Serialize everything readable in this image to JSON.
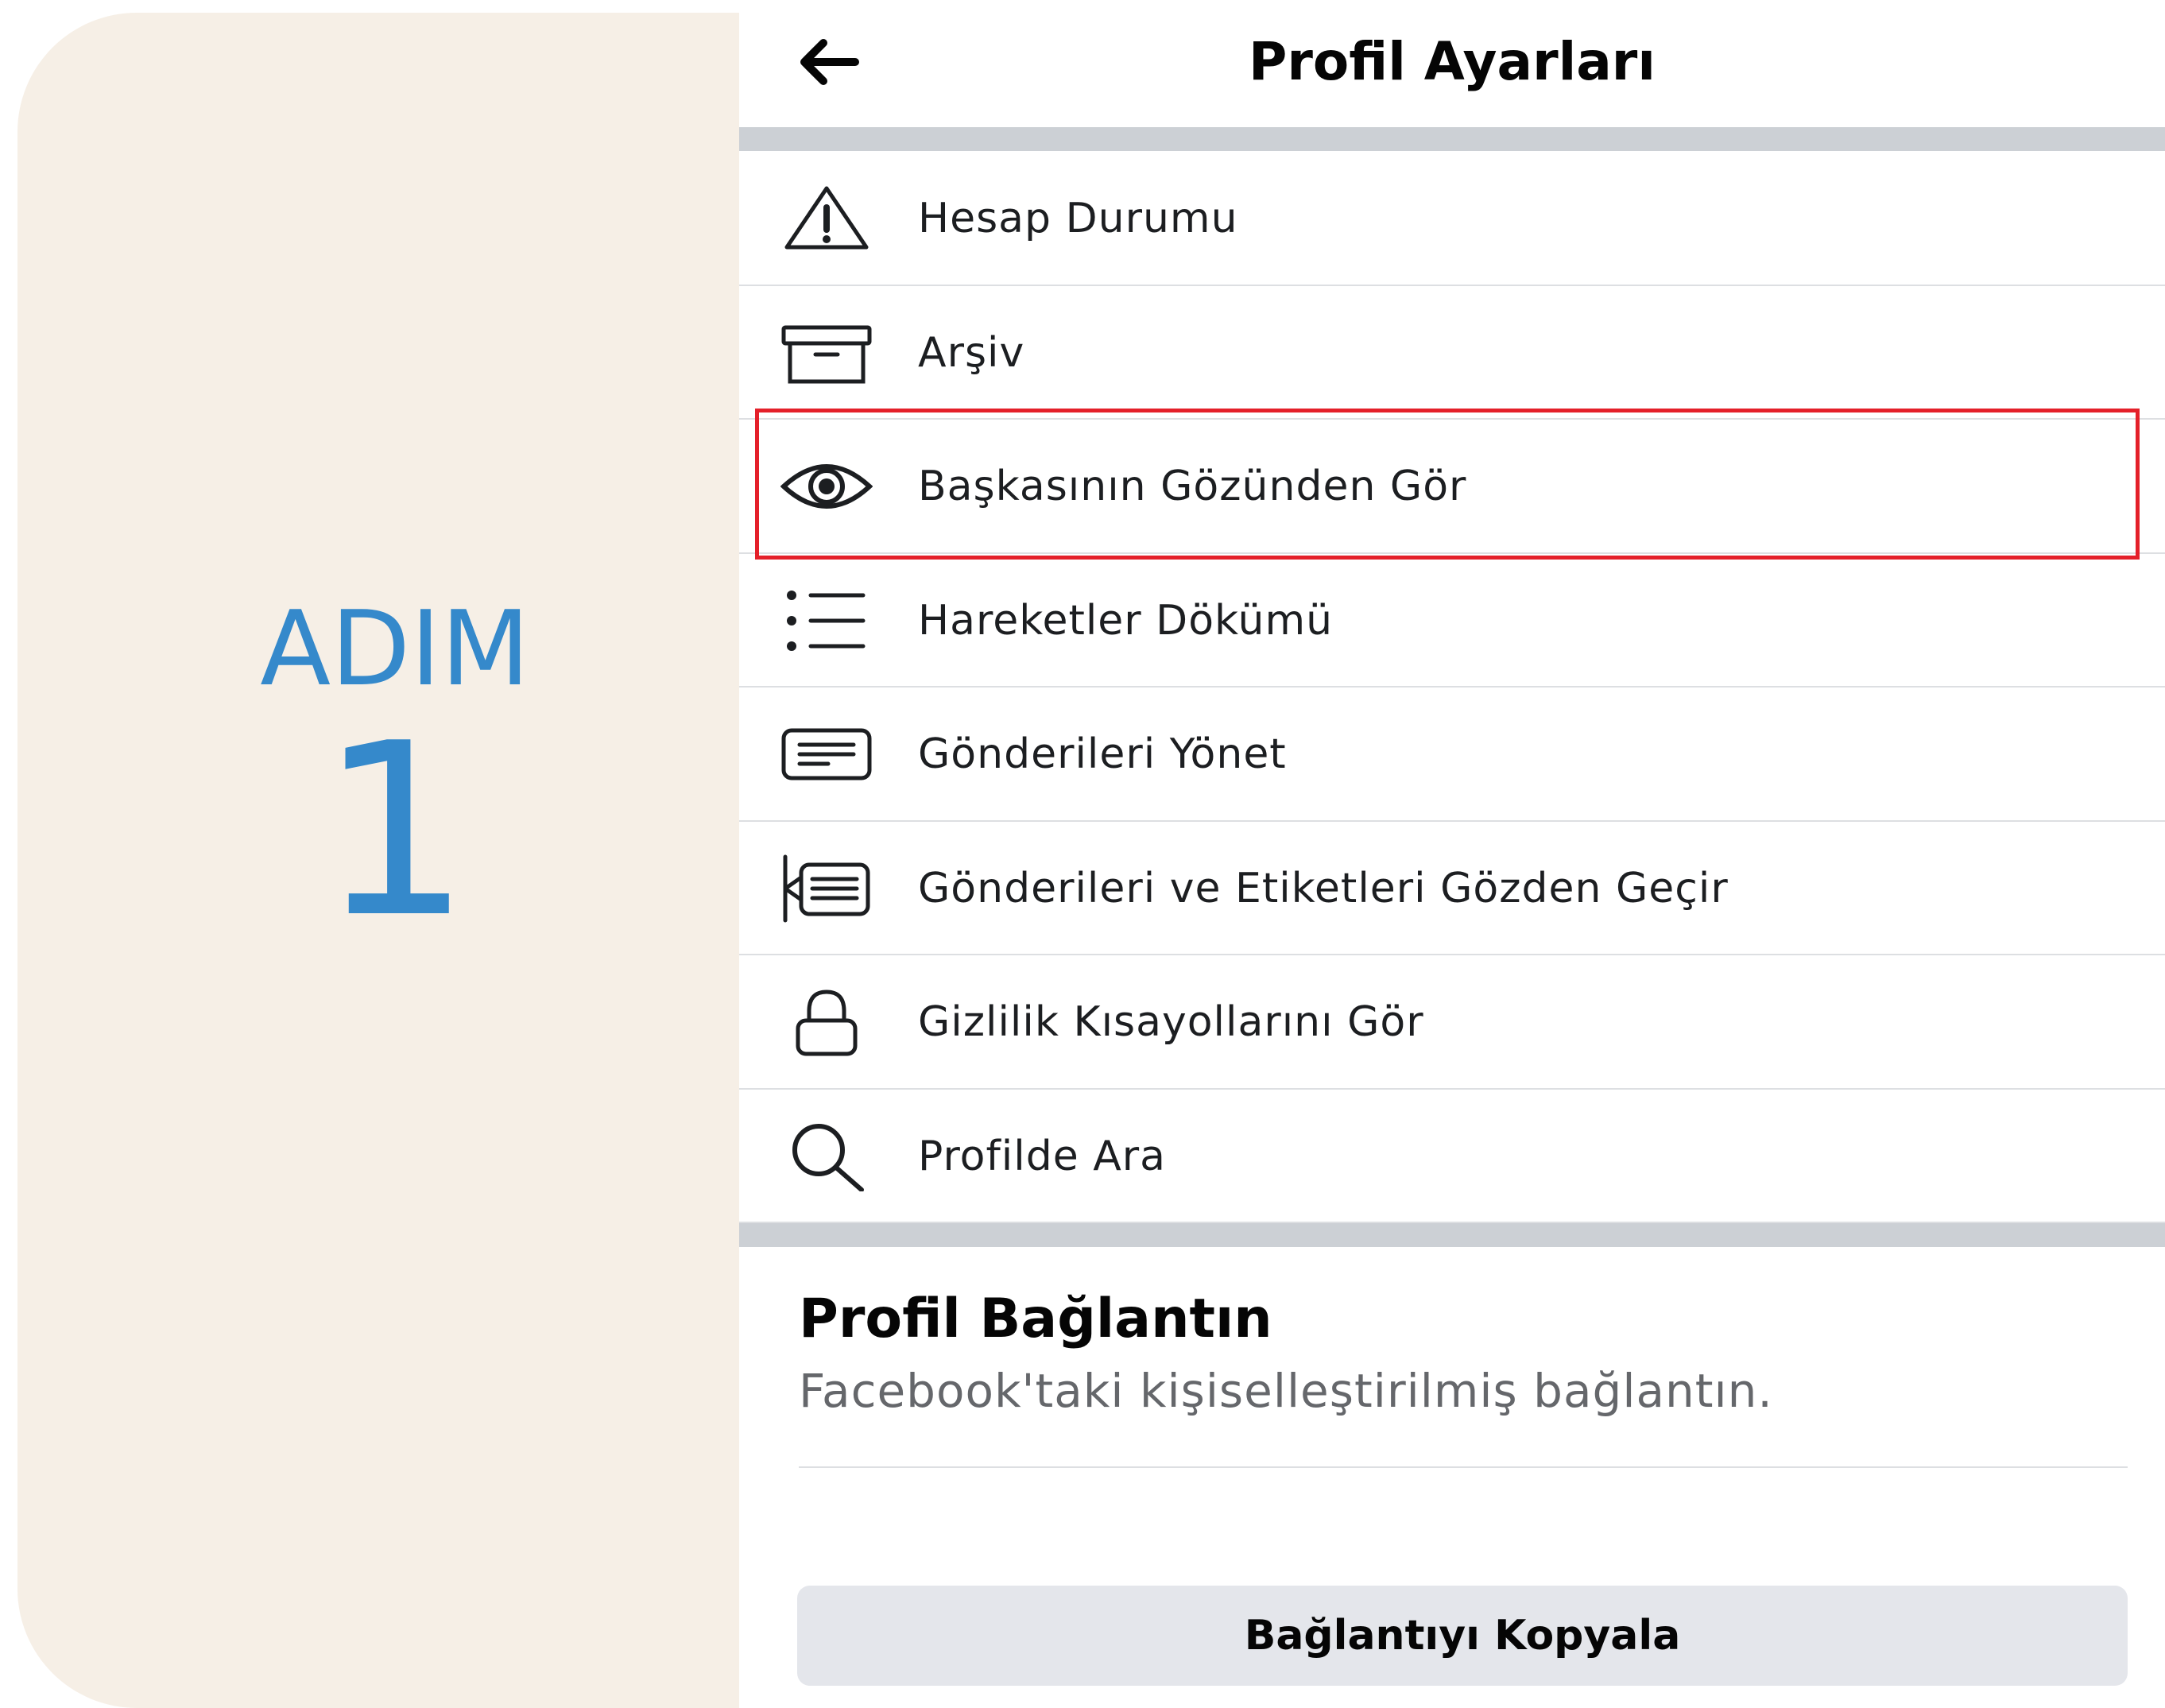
{
  "step_panel": {
    "word": "ADIM",
    "number": "1"
  },
  "header": {
    "title": "Profil Ayarları",
    "back_icon": "back-arrow-icon"
  },
  "menu": {
    "items": [
      {
        "label": "Hesap Durumu",
        "icon": "warning-icon"
      },
      {
        "label": "Arşiv",
        "icon": "archive-icon"
      },
      {
        "label": "Başkasının Gözünden Gör",
        "icon": "eye-icon",
        "highlighted": true
      },
      {
        "label": "Hareketler Dökümü",
        "icon": "list-icon"
      },
      {
        "label": "Gönderileri Yönet",
        "icon": "posts-icon"
      },
      {
        "label": "Gönderileri ve Etiketleri Gözden Geçir",
        "icon": "review-posts-icon"
      },
      {
        "label": "Gizlilik Kısayollarını Gör",
        "icon": "lock-icon"
      },
      {
        "label": "Profilde Ara",
        "icon": "search-icon"
      }
    ]
  },
  "profile_link": {
    "title": "Profil Bağlantın",
    "subtitle": "Facebook'taki kişiselleştirilmiş bağlantın.",
    "copy_button": "Bağlantıyı Kopyala"
  },
  "colors": {
    "highlight": "#e4202a",
    "step_text": "#3589cb",
    "left_background": "#f6efe6",
    "separator": "#ccd0d5"
  }
}
